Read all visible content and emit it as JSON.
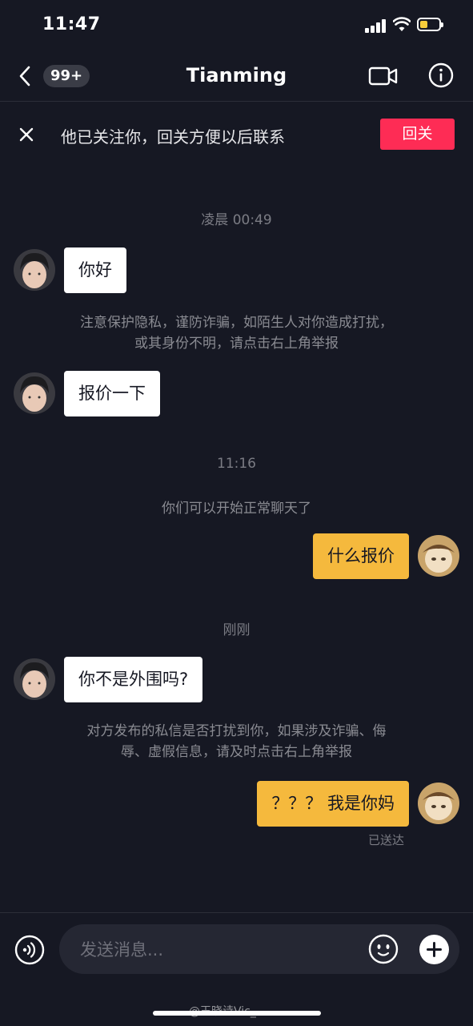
{
  "status_bar": {
    "time": "11:47"
  },
  "nav": {
    "unread_badge": "99+",
    "title": "Tianming"
  },
  "banner": {
    "text": "他已关注你，回关方便以后联系",
    "button": "回关"
  },
  "chat": {
    "timestamp_1": "凌晨 00:49",
    "msg_1": "你好",
    "notice_1_line1": "注意保护隐私，谨防诈骗，如陌生人对你造成打扰，",
    "notice_1_line2": "或其身份不明，请点击右上角举报",
    "msg_2": "报价一下",
    "timestamp_2": "11:16",
    "system_1": "你们可以开始正常聊天了",
    "msg_3": "什么报价",
    "timestamp_3": "刚刚",
    "msg_4": "你不是外围吗?",
    "notice_2_line1": "对方发布的私信是否打扰到你，如果涉及诈骗、侮",
    "notice_2_line2": "辱、虚假信息，请及时点击右上角举报",
    "msg_5": "？？？ 我是你妈",
    "delivered": "已送达"
  },
  "input": {
    "placeholder": "发送消息..."
  },
  "watermark": "@王晓诗Vic_",
  "colors": {
    "background": "#161823",
    "accent_red": "#fe2c55",
    "outgoing_bubble": "#f5b93d",
    "incoming_bubble": "#ffffff",
    "battery_fill": "#f7cd3b"
  },
  "icons": [
    "back-icon",
    "video-call-icon",
    "info-icon",
    "close-icon",
    "voice-icon",
    "emoji-icon",
    "plus-icon",
    "signal-icon",
    "wifi-icon",
    "battery-icon"
  ]
}
